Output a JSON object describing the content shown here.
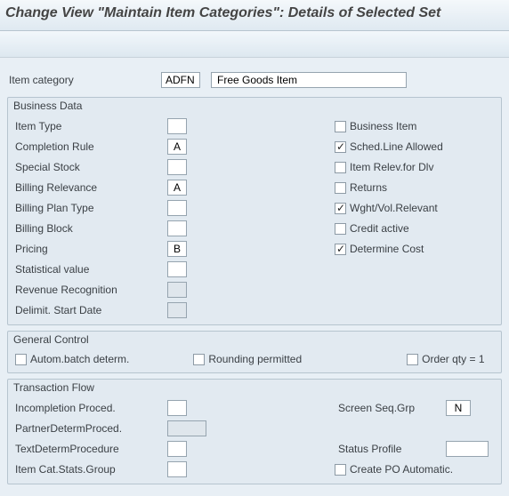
{
  "title": "Change View \"Maintain Item Categories\": Details of Selected Set",
  "header": {
    "item_category_label": "Item category",
    "item_category_code": "ADFN",
    "item_category_desc": "Free Goods Item"
  },
  "business_data": {
    "title": "Business Data",
    "left": [
      {
        "name": "item-type",
        "label": "Item Type",
        "value": "",
        "grey": false
      },
      {
        "name": "completion-rule",
        "label": "Completion Rule",
        "value": "A",
        "grey": false
      },
      {
        "name": "special-stock",
        "label": "Special Stock",
        "value": "",
        "grey": false
      },
      {
        "name": "billing-relevance",
        "label": "Billing Relevance",
        "value": "A",
        "grey": false
      },
      {
        "name": "billing-plan-type",
        "label": "Billing Plan Type",
        "value": "",
        "grey": false
      },
      {
        "name": "billing-block",
        "label": "Billing Block",
        "value": "",
        "grey": false
      },
      {
        "name": "pricing",
        "label": "Pricing",
        "value": "B",
        "grey": false
      },
      {
        "name": "statistical-value",
        "label": "Statistical value",
        "value": "",
        "grey": false
      },
      {
        "name": "revenue-recognition",
        "label": "Revenue Recognition",
        "value": "",
        "grey": true
      },
      {
        "name": "delimit-start-date",
        "label": "Delimit. Start Date",
        "value": "",
        "grey": true
      }
    ],
    "right": [
      {
        "name": "business-item",
        "label": "Business Item",
        "checked": false
      },
      {
        "name": "sched-line-allowed",
        "label": "Sched.Line Allowed",
        "checked": true
      },
      {
        "name": "item-relev-for-dlv",
        "label": "Item Relev.for Dlv",
        "checked": false
      },
      {
        "name": "returns",
        "label": "Returns",
        "checked": false
      },
      {
        "name": "wght-vol-relevant",
        "label": "Wght/Vol.Relevant",
        "checked": true
      },
      {
        "name": "credit-active",
        "label": "Credit active",
        "checked": false
      },
      {
        "name": "determine-cost",
        "label": "Determine Cost",
        "checked": true
      }
    ]
  },
  "general_control": {
    "title": "General Control",
    "autom_batch_label": "Autom.batch determ.",
    "autom_batch_checked": false,
    "rounding_label": "Rounding permitted",
    "rounding_checked": false,
    "order_qty_label": "Order qty = 1",
    "order_qty_checked": false
  },
  "transaction_flow": {
    "title": "Transaction Flow",
    "left": [
      {
        "name": "incompletion-proced",
        "label": "Incompletion Proced.",
        "value": "",
        "grey": false
      },
      {
        "name": "partner-determ-proced",
        "label": "PartnerDetermProced.",
        "value": "",
        "grey": true
      },
      {
        "name": "text-determ-procedure",
        "label": "TextDetermProcedure",
        "value": "",
        "grey": false
      },
      {
        "name": "item-cat-stats-group",
        "label": "Item Cat.Stats.Group",
        "value": "",
        "grey": false
      }
    ],
    "screen_seq_label": "Screen Seq.Grp",
    "screen_seq_value": "N",
    "status_profile_label": "Status Profile",
    "status_profile_value": "",
    "create_po_label": "Create PO Automatic.",
    "create_po_checked": false
  }
}
